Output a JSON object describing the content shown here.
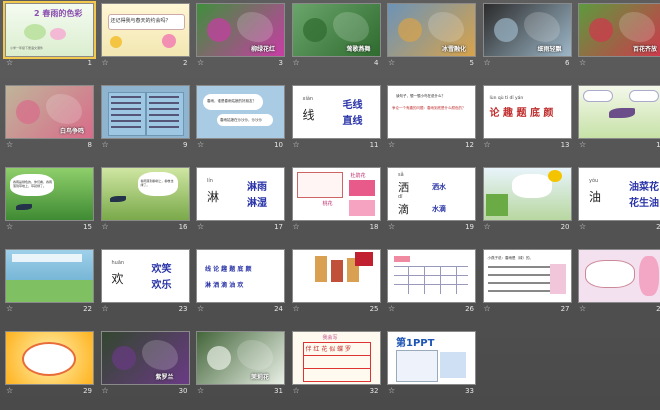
{
  "slides": [
    {
      "n": "1",
      "kind": "title",
      "bg": "#eaf6e8",
      "main": "2 春雨的色彩",
      "sub": "小学一年级下册语文课件"
    },
    {
      "n": "2",
      "kind": "banner",
      "bg": "#f8f3d8",
      "main": "还记得我与春天的约会吗？"
    },
    {
      "n": "3",
      "kind": "photo",
      "bg": "#3f8f3c",
      "accent": "#c93ca5",
      "caption": "柳绿花红"
    },
    {
      "n": "4",
      "kind": "photo",
      "bg": "#6aa66b",
      "accent": "#2f6b2f",
      "caption": "莺歌燕舞"
    },
    {
      "n": "5",
      "kind": "photo",
      "bg": "#6c93b7",
      "accent": "#d8a34a",
      "caption": "冰雪融化"
    },
    {
      "n": "6",
      "kind": "photo",
      "bg": "#2b2b2b",
      "accent": "#9db7c8",
      "caption": "细雨轻飘"
    },
    {
      "n": "7",
      "kind": "photo",
      "bg": "#5d9a3d",
      "accent": "#d2364d",
      "caption": "百花齐放"
    },
    {
      "n": "8",
      "kind": "photo",
      "bg": "#bfb59a",
      "accent": "#d96b8a",
      "caption": "白鸟争鸣"
    },
    {
      "n": "9",
      "kind": "book",
      "bg": "#8eb4cf"
    },
    {
      "n": "10",
      "kind": "clouds",
      "bg": "#a9cbe4",
      "main": "春雨，谁是春雨姑娘的好朋友？",
      "sub": "春雨姑娘在沙沙沙，沙沙沙"
    },
    {
      "n": "11",
      "kind": "words",
      "bg": "#ffffff",
      "pinyin": "xiàn",
      "char": "线",
      "w1": "毛线",
      "w2": "直线"
    },
    {
      "n": "12",
      "kind": "question",
      "bg": "#ffffff",
      "main": "读句子，想一想小鸟在说什么？",
      "sub": "争论一个有趣的问题：春雨到底是什么颜色的？"
    },
    {
      "n": "13",
      "kind": "pinyinrow",
      "bg": "#ffffff",
      "pinyin": "lùn  qù  tí  dǐ  yán",
      "chars": "论 趣 题 底 颜"
    },
    {
      "n": "14",
      "kind": "bird",
      "bg": "#e8f2d8"
    },
    {
      "n": "15",
      "kind": "field",
      "bg": "#6fae4a",
      "main": "春雨是绿色的，你们看，春雨落到草地上，草就绿了。"
    },
    {
      "n": "16",
      "kind": "willow",
      "bg": "#a8c97e",
      "main": "春雨落到柳树上，柳枝也绿了。"
    },
    {
      "n": "17",
      "kind": "words",
      "bg": "#ffffff",
      "pinyin": "lín",
      "char": "淋",
      "w1": "淋雨",
      "w2": "淋湿"
    },
    {
      "n": "18",
      "kind": "flower",
      "bg": "#ffffff",
      "main": "杜鹃花",
      "sub": "桃花"
    },
    {
      "n": "19",
      "kind": "words2",
      "bg": "#ffffff",
      "pinyin": "sǎ",
      "char": "洒",
      "w1": "洒水",
      "pinyin2": "dī",
      "char2": "滴",
      "w2": "水滴"
    },
    {
      "n": "20",
      "kind": "cloudbird",
      "bg": "#cfe5f2"
    },
    {
      "n": "21",
      "kind": "words",
      "bg": "#ffffff",
      "pinyin": "yóu",
      "char": "油",
      "w1": "油菜花",
      "w2": "花生油"
    },
    {
      "n": "22",
      "kind": "green",
      "bg": "#7fb8d8"
    },
    {
      "n": "23",
      "kind": "words",
      "bg": "#ffffff",
      "pinyin": "huān",
      "char": "欢",
      "w1": "欢笑",
      "w2": "欢乐"
    },
    {
      "n": "24",
      "kind": "chars",
      "bg": "#ffffff",
      "line1": "线 论 趣 题 底 颜",
      "line2": "淋 洒 滴 油 欢"
    },
    {
      "n": "25",
      "kind": "candles",
      "bg": "#ffffff"
    },
    {
      "n": "26",
      "kind": "table",
      "bg": "#ffffff"
    },
    {
      "n": "27",
      "kind": "answers",
      "bg": "#ffffff",
      "main": "小燕子说：春雨是（绿）的。"
    },
    {
      "n": "28",
      "kind": "girl",
      "bg": "#f3e1ef"
    },
    {
      "n": "29",
      "kind": "sun",
      "bg": "#ffb21e"
    },
    {
      "n": "30",
      "kind": "photo",
      "bg": "#33472f",
      "accent": "#6a3a85",
      "caption": "紫罗兰"
    },
    {
      "n": "31",
      "kind": "photo",
      "bg": "#44663b",
      "accent": "#e9f0e6",
      "caption": "茉莉花"
    },
    {
      "n": "32",
      "kind": "grid",
      "bg": "#fffaf0",
      "main": "我会写",
      "chars": "伴 红 花 似 蝶 罗"
    },
    {
      "n": "33",
      "kind": "ppt",
      "bg": "#ffffff",
      "main": "第1PPT"
    }
  ]
}
